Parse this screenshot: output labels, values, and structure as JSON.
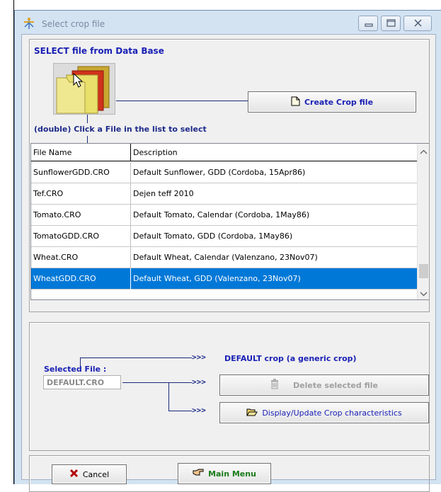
{
  "window": {
    "title": "Select crop file"
  },
  "section": {
    "heading": "SELECT file from Data Base",
    "instruction": "(double) Click a File in the list to select"
  },
  "buttons": {
    "create": "Create Crop file",
    "delete": "Delete selected file",
    "display": "Display/Update Crop characteristics",
    "cancel": "Cancel",
    "main_menu": "Main Menu"
  },
  "table": {
    "headers": [
      "File Name",
      "Description"
    ],
    "rows": [
      {
        "file": "SunflowerGDD.CRO",
        "desc": "Default Sunflower, GDD (Cordoba, 15Apr86)"
      },
      {
        "file": "Tef.CRO",
        "desc": "Dejen teff 2010"
      },
      {
        "file": "Tomato.CRO",
        "desc": "Default Tomato, Calendar (Cordoba, 1May86)"
      },
      {
        "file": "TomatoGDD.CRO",
        "desc": "Default Tomato, GDD (Cordoba, 1May86)"
      },
      {
        "file": "Wheat.CRO",
        "desc": "Default Wheat, Calendar (Valenzano, 23Nov07)"
      },
      {
        "file": "WheatGDD.CRO",
        "desc": "Default Wheat, GDD (Valenzano, 23Nov07)"
      }
    ],
    "selected_row": 5
  },
  "selection": {
    "label": "Selected File :",
    "value": "DEFAULT.CRO",
    "arrow": ">>>",
    "default_text": "DEFAULT crop (a generic crop)"
  },
  "colors": {
    "accent_blue": "#1a21b5",
    "selection": "#0078d7",
    "window_frame": "#d3e3f2",
    "cancel_x": "#b10000",
    "main_menu_green": "#1a7a1a"
  },
  "icons": {
    "app": "aquacrop-icon",
    "folder": "folder-stack-icon",
    "create": "new-document-icon",
    "delete": "trash-can-icon",
    "display": "open-folder-icon",
    "cancel": "red-x-icon",
    "main_menu": "pointing-hand-icon"
  }
}
